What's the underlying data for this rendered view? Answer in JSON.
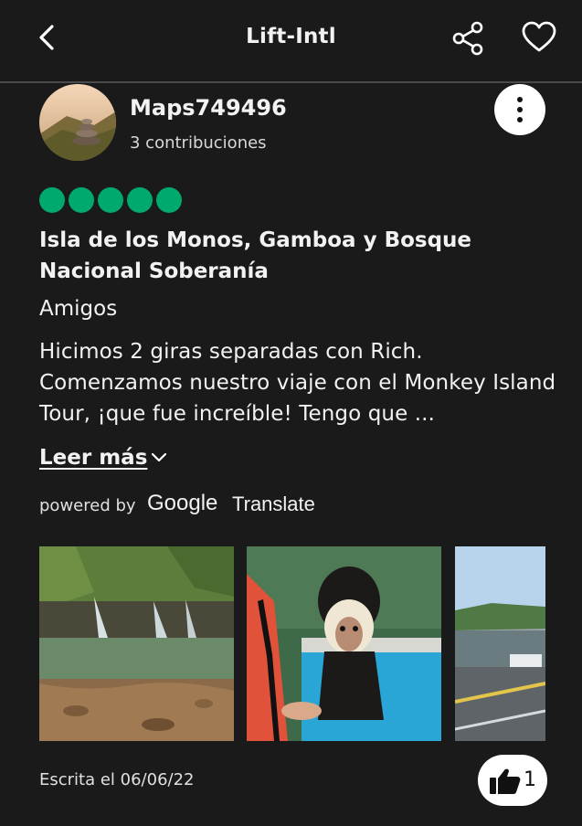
{
  "header": {
    "title": "Lift-Intl",
    "icons": [
      "back-arrow-icon",
      "share-icon",
      "heart-icon"
    ]
  },
  "reviewer": {
    "username": "Maps749496",
    "contributions": "3 contribuciones"
  },
  "review": {
    "rating": 5,
    "rating_max": 5,
    "rating_color": "#00aa6c",
    "title": "Isla de los Monos, Gamboa y Bosque Nacional Soberanía",
    "trip_type": "Amigos",
    "text": "Hicimos 2 giras separadas con Rich. Comenzamos nuestro viaje con el Monkey Island Tour, ¡que fue increíble! Tengo que ...",
    "read_more": "Leer más",
    "powered_by": "powered by",
    "google": "Google",
    "translate": "Translate",
    "written": "Escrita el 06/06/22",
    "likes": "1"
  },
  "photos": [
    "waterfall-photo",
    "capuchin-monkey-photo",
    "canal-locks-photo"
  ]
}
